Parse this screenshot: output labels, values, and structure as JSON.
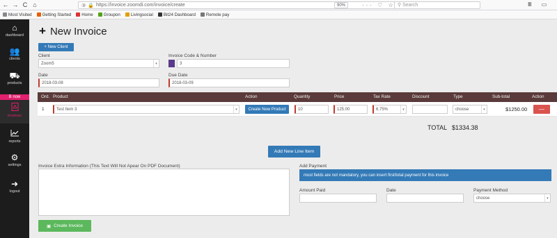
{
  "browser": {
    "back": "←",
    "forward": "→",
    "reload": "C",
    "home": "⌂",
    "url_prefix": "③",
    "url": "https://invoice.zoomdi.com/invoice/create",
    "zoom": "90%",
    "url_icons": "··· ♡ ☆",
    "search_placeholder": "Search",
    "right_icons": "Ⅲ ▭"
  },
  "bookmarks": [
    {
      "label": "Most Visited",
      "color": "#888888"
    },
    {
      "label": "Getting Started",
      "color": "#e66000"
    },
    {
      "label": "Home",
      "color": "#d33"
    },
    {
      "label": "Groupon",
      "color": "#53a318"
    },
    {
      "label": "Livingsocial",
      "color": "#e0a000"
    },
    {
      "label": "Bit24 Dashboard",
      "color": "#333333"
    },
    {
      "label": "Remote pay",
      "color": "#777777"
    }
  ],
  "sidebar": {
    "items": [
      {
        "label": "dashboard",
        "icon": "⌂"
      },
      {
        "label": "clients",
        "icon": "👥"
      },
      {
        "label": "products",
        "icon": "⛟"
      },
      {
        "label": "invoices",
        "icon": "⎙"
      },
      {
        "label": "reports",
        "icon": "📈"
      },
      {
        "label": "settings",
        "icon": "⚙"
      },
      {
        "label": "logout",
        "icon": "➜"
      }
    ],
    "now_badge": "B now"
  },
  "page": {
    "title": "New Invoice",
    "plus": "+"
  },
  "new_client_button": "+ New Client",
  "client": {
    "label": "Client",
    "value": "Zoom5"
  },
  "invoice_code": {
    "label": "Invoice Code & Number",
    "value": "3",
    "color": "#5b3a8c"
  },
  "date": {
    "label": "Date",
    "value": "2018-03-08"
  },
  "due_date": {
    "label": "Due Date",
    "value": "2018-03-09"
  },
  "table": {
    "headers": [
      "Ord.",
      "Product",
      "Action",
      "Quantity",
      "Price",
      "Tax Rate",
      "Discount",
      "Type",
      "Sub-total",
      "Action"
    ],
    "rows": [
      {
        "ord": "1",
        "product": "Test Item 3",
        "action_label": "Create New Product",
        "quantity": "10",
        "price": "125.00",
        "tax_rate": "6.75%",
        "discount": "",
        "type": "choose",
        "subtotal": "$1250.00",
        "remove_label": "—"
      }
    ]
  },
  "total": {
    "label": "TOTAL",
    "value": "$1334.38"
  },
  "add_line_item_button": "Add New Line Item",
  "extra_info": {
    "label": "Invoice Extra Information (This Text Will Not Apear On PDF Document)"
  },
  "payment": {
    "label": "Add Payment",
    "banner": "most fields are not mandatory, you can insert first/total payment for this invoice",
    "amount_label": "Amount Paid",
    "date_label": "Date",
    "method_label": "Payment Method",
    "method_value": "choose"
  },
  "create_invoice_button": "Create Invoice"
}
